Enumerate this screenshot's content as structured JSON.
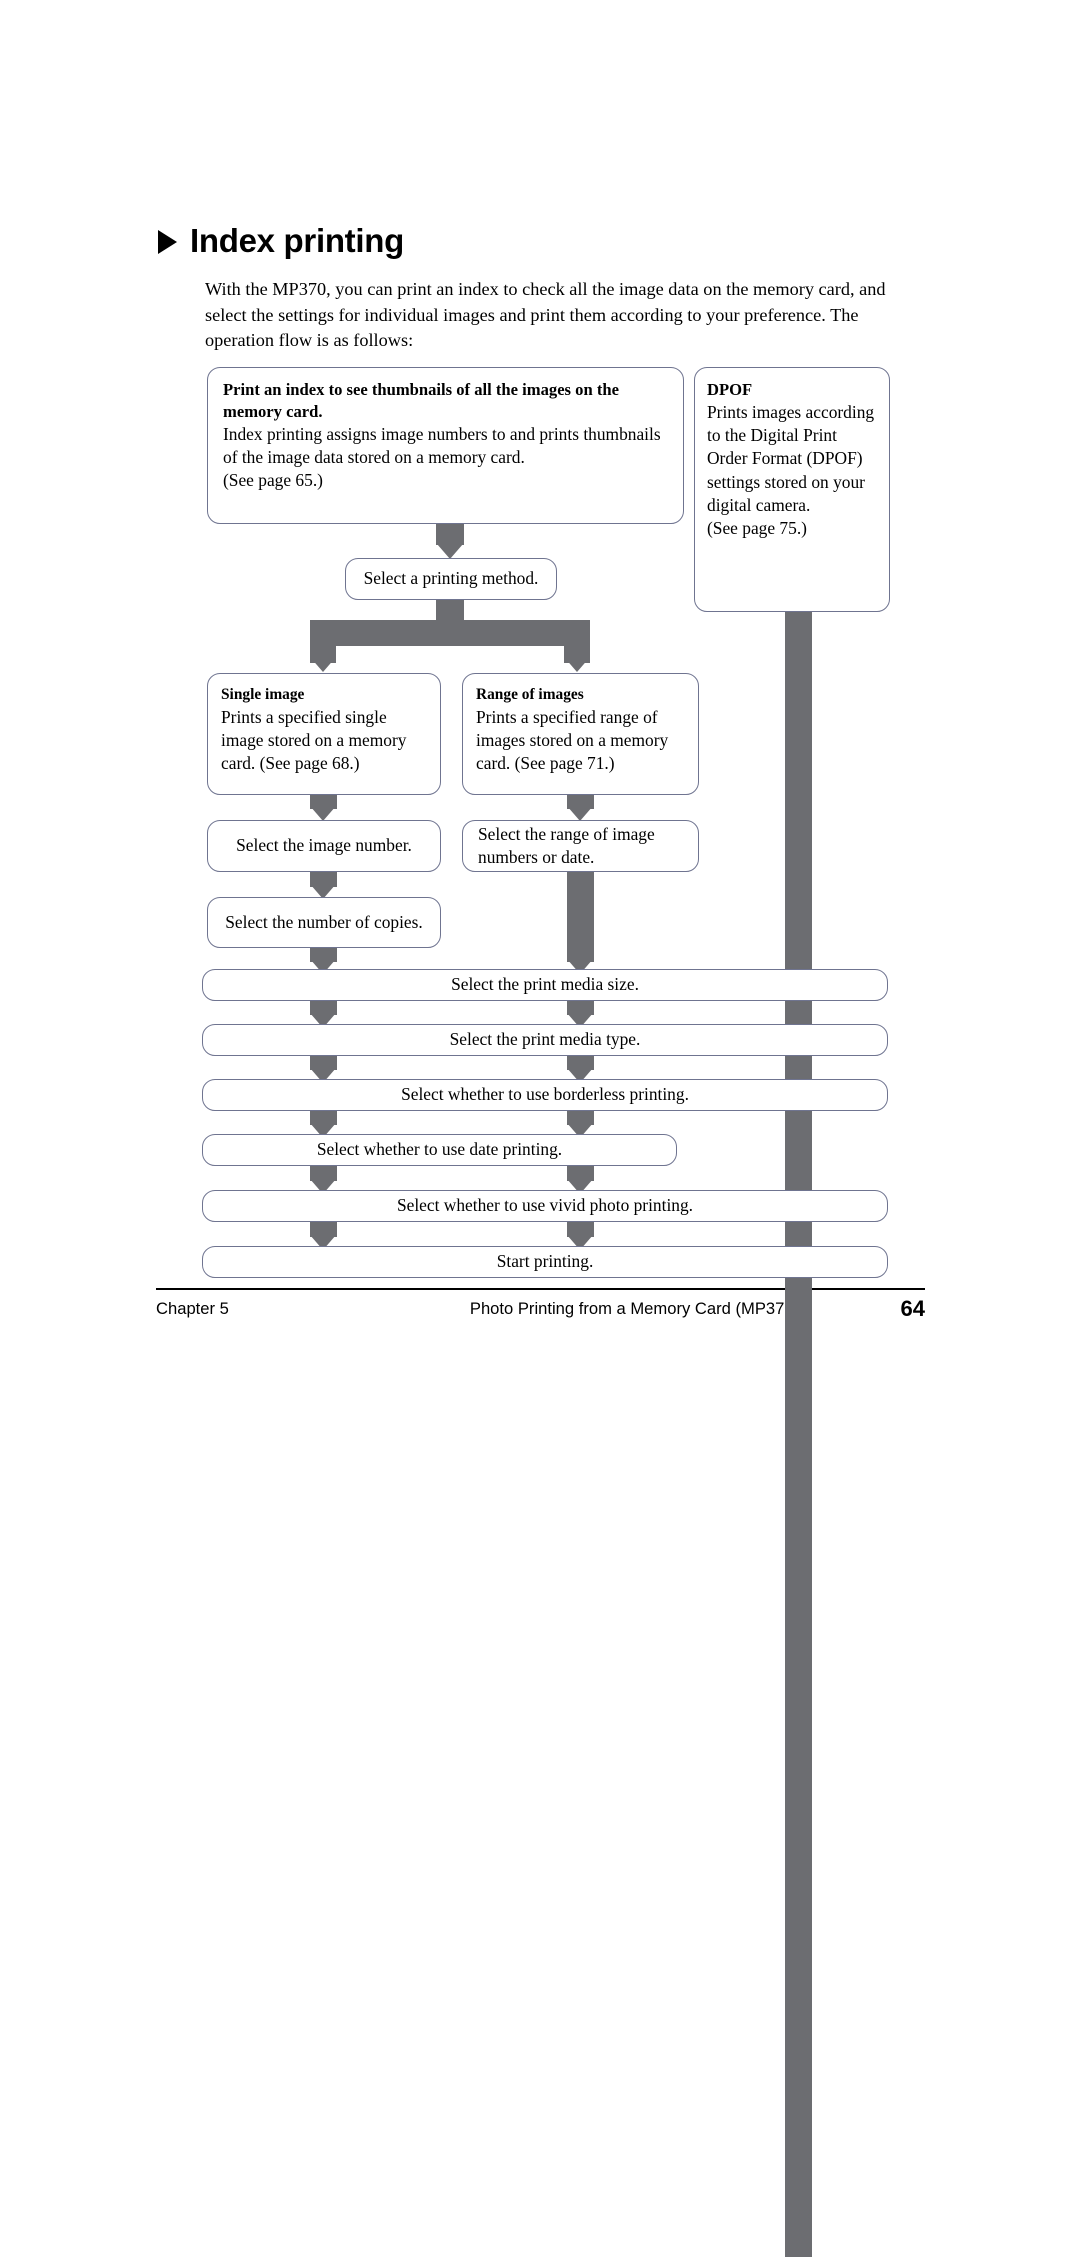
{
  "heading": {
    "icon": "triangle-bullet",
    "title": "Index printing"
  },
  "intro": "With the MP370, you can print an index to check all the image data on the memory card, and select the settings for individual images and print them according to your preference. The operation flow is as follows:",
  "flow": {
    "index_box": {
      "lead": "Print an index to see thumbnails of all the images on the memory card.",
      "body": "Index printing assigns image numbers to and prints thumbnails of the image data stored on a memory card.",
      "ref": "(See page 65.)"
    },
    "dpof_box": {
      "lead": "DPOF",
      "body": "Prints images according to the Digital Print Order Format (DPOF) settings stored on your digital camera.",
      "ref": "(See page 75.)"
    },
    "select_method": "Select a printing method.",
    "single_image": {
      "lead": "Single image",
      "body": "Prints a specified single image stored on a memory card. (See page 68.)"
    },
    "range_of_images": {
      "lead": "Range of images",
      "body": "Prints a specified range of images stored on a memory card. (See page 71.)"
    },
    "select_image_number": "Select the image number.",
    "select_range": "Select the range of image numbers or date.",
    "select_copies": "Select the number of copies.",
    "select_media_size": "Select the print media size.",
    "select_media_type": "Select the print media type.",
    "select_borderless": "Select whether to use borderless printing.",
    "select_date_printing": "Select whether to use date printing.",
    "select_vivid": "Select whether to use vivid photo printing.",
    "start_printing": "Start printing."
  },
  "footer": {
    "chapter": "Chapter 5",
    "title": "Photo Printing from a Memory Card (MP370)",
    "page": "64"
  },
  "colors": {
    "arrow_gray": "#6c6d71",
    "box_border": "#6f7490",
    "text": "#000000"
  }
}
